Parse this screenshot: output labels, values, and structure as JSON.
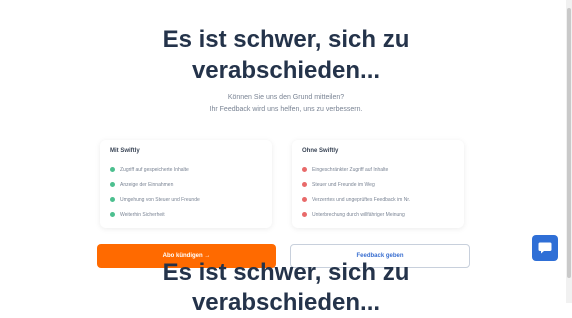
{
  "heading": {
    "line1": "Es ist schwer, sich zu",
    "line2": "verabschieden..."
  },
  "subtitle": {
    "line1": "Können Sie uns den Grund mitteilen?",
    "line2": "Ihr Feedback wird uns helfen, uns zu verbessern."
  },
  "with_list": {
    "title": "Mit Swiftly",
    "items": [
      "Zugriff auf gespeicherte Inhalte",
      "Anzeige der Einnahmen",
      "Umgehung von Steuer und Freunde",
      "Weiterhin Sicherheit"
    ]
  },
  "without_list": {
    "title": "Ohne Swiftly",
    "items": [
      "Eingeschränkter Zugriff auf Inhalte",
      "Steuer und Freunde im Weg",
      "Verzerrtes und ungeprüftes Feedback im Nr.",
      "Unterbrechung durch willfähriger Meinung"
    ]
  },
  "buttons": {
    "primary": "Abo kündigen →",
    "secondary": "Feedback geben"
  },
  "colors": {
    "accent": "#ff6a00",
    "chat": "#2f6fd6",
    "ok": "#4cbf8f",
    "no": "#e86a6a"
  },
  "icons": {
    "chat": "chat-bubble-icon"
  }
}
